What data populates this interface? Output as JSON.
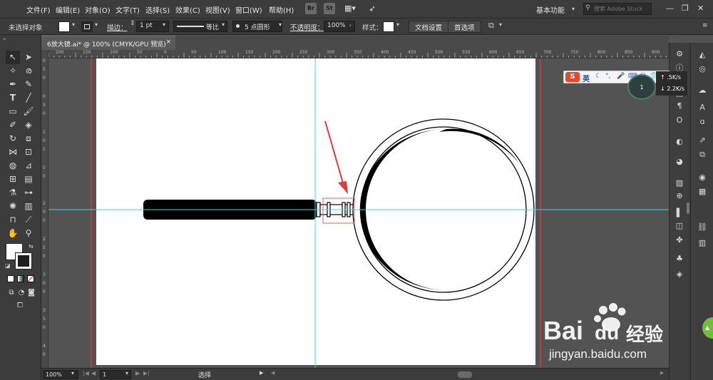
{
  "menubar": {
    "items": [
      "文件(F)",
      "编辑(E)",
      "对象(O)",
      "文字(T)",
      "选择(S)",
      "效果(C)",
      "视图(V)",
      "窗口(W)",
      "帮助(H)"
    ],
    "bridge_icon": "Br",
    "stock_icon": "St",
    "workspace": "基本功能",
    "search_placeholder": "搜索 Adobe Stock",
    "minimize": "—",
    "restore": "❐",
    "close": "✕"
  },
  "controlbar": {
    "selection": "未选择对象",
    "stroke_label": "描边：",
    "stroke_weight": "1 pt",
    "profile_label": "等比",
    "brush": "5 点圆形",
    "opacity_label": "不透明度：",
    "opacity": "100%",
    "style_label": "样式：",
    "doc_setup": "文档设置",
    "preferences": "首选项"
  },
  "document": {
    "tab_title": "6放大镜.ai* @ 100% (CMYK/GPU 预览)",
    "tab_close": "×"
  },
  "rulers": {
    "top": [
      "200",
      "150",
      "100",
      "50",
      "0",
      "50",
      "100",
      "150",
      "200",
      "250",
      "300",
      "350",
      "400",
      "450",
      "500",
      "550",
      "600",
      "650",
      "700",
      "750",
      "800",
      "850",
      "900"
    ],
    "left": [
      "0",
      "5",
      "0",
      "0",
      "5",
      "0",
      "1",
      "0",
      "1",
      "5",
      "0",
      "2",
      "0",
      "0",
      "2",
      "5",
      "0",
      "3",
      "0",
      "0",
      "3",
      "5",
      "0",
      "4",
      "0"
    ]
  },
  "statusbar": {
    "zoom": "100%",
    "page": "1",
    "mode": "选择"
  },
  "ime": {
    "lang": "英"
  },
  "net": {
    "percent": "1",
    "up": "↑ .5K/s",
    "down": "↓ 2.2K/s"
  },
  "watermark": {
    "brand": "Bai",
    "brand_cn": "经验",
    "url": "jingyan.baidu.com"
  },
  "colors": {
    "guide": "#4fd3d3",
    "bleed": "#d23c3c",
    "annotation": "#e03a3a",
    "selection_box": "#e06060"
  }
}
